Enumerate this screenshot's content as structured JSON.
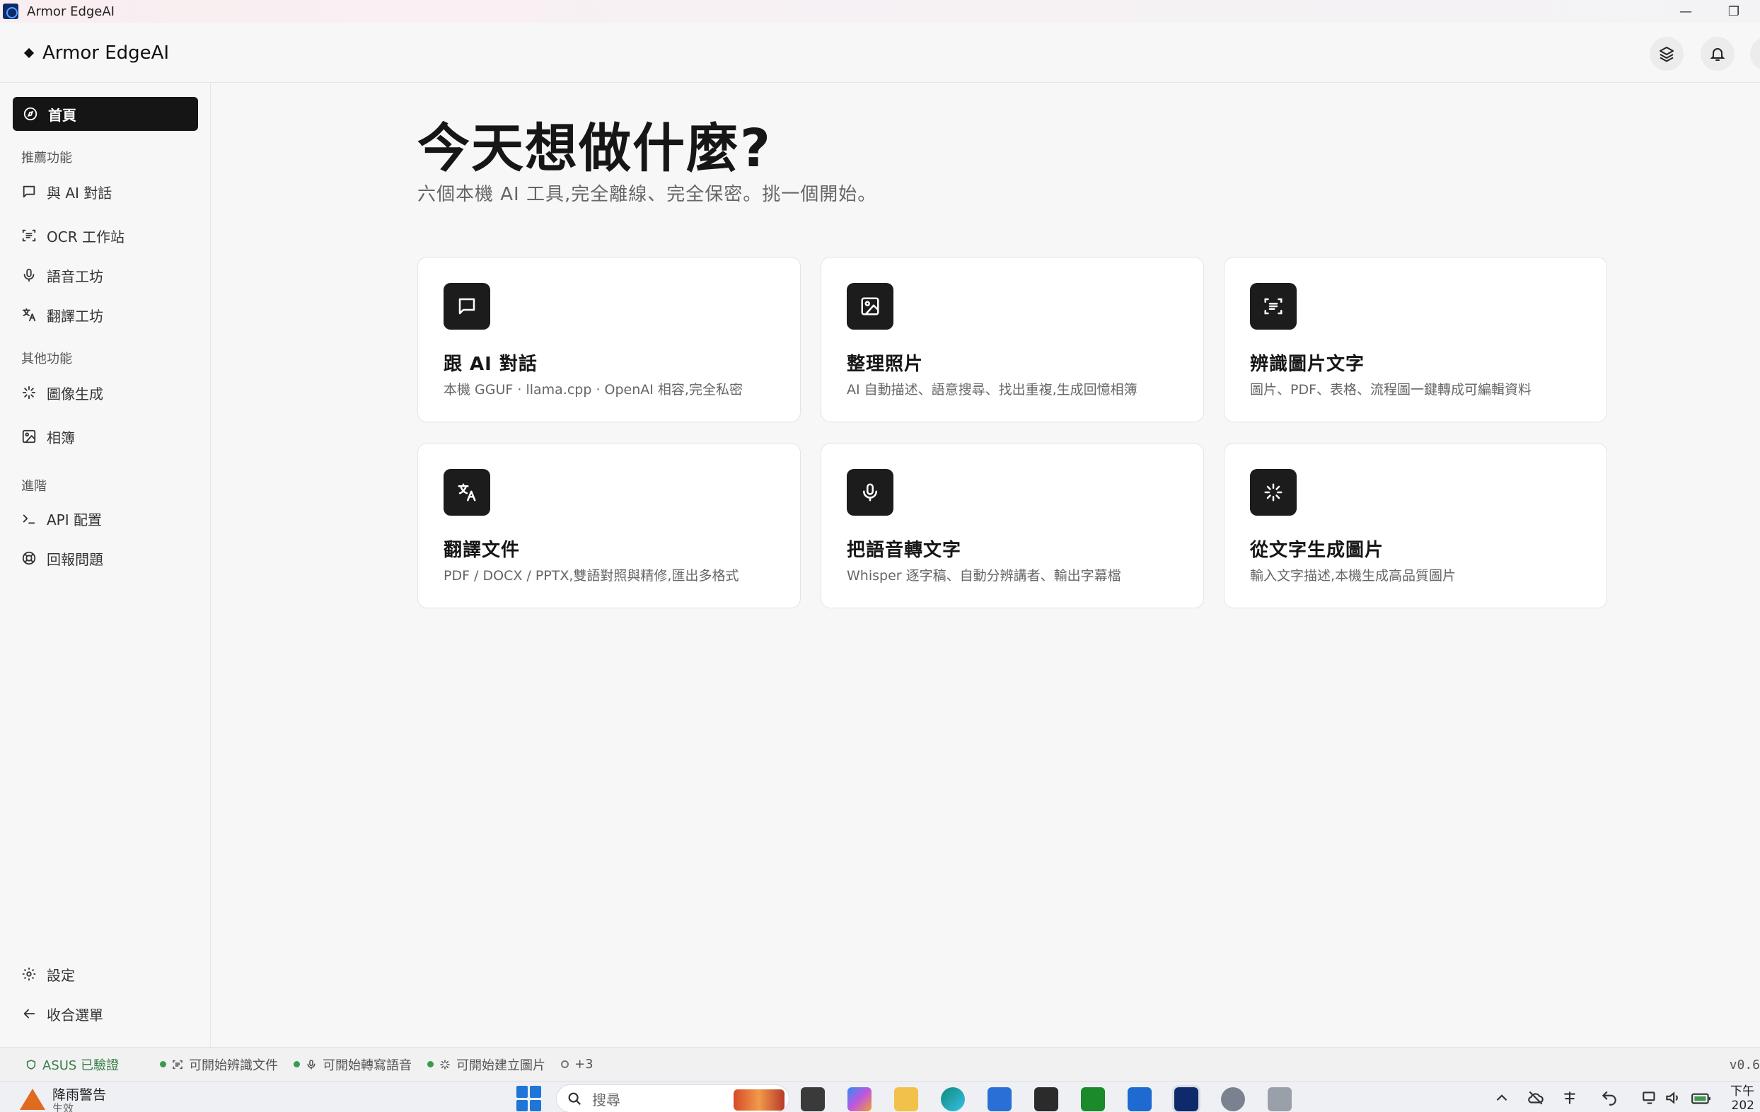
{
  "window": {
    "title": "Armor EdgeAI",
    "minimize_glyph": "—",
    "restore_glyph": "❐"
  },
  "header": {
    "brand": "Armor EdgeAI",
    "layers_icon": "layers-icon",
    "bell_icon": "bell-icon"
  },
  "sidebar": {
    "home": "首頁",
    "sections": {
      "recommended": "推薦功能",
      "other": "其他功能",
      "advanced": "進階"
    },
    "items": {
      "chat": "與 AI 對話",
      "ocr": "OCR 工作站",
      "voice": "語音工坊",
      "translate": "翻譯工坊",
      "image_gen": "圖像生成",
      "album": "相簿",
      "api": "API 配置",
      "report": "回報問題",
      "settings": "設定",
      "collapse": "收合選單"
    }
  },
  "main": {
    "title": "今天想做什麼?",
    "subtitle": "六個本機 AI 工具,完全離線、完全保密。挑一個開始。",
    "cards": [
      {
        "title": "跟 AI 對話",
        "desc": "本機 GGUF · llama.cpp · OpenAI 相容,完全私密",
        "icon": "chat-icon"
      },
      {
        "title": "整理照片",
        "desc": "AI 自動描述、語意搜尋、找出重複,生成回憶相簿",
        "icon": "image-icon"
      },
      {
        "title": "辨識圖片文字",
        "desc": "圖片、PDF、表格、流程圖一鍵轉成可編輯資料",
        "icon": "scan-text-icon"
      },
      {
        "title": "翻譯文件",
        "desc": "PDF / DOCX / PPTX,雙語對照與精修,匯出多格式",
        "icon": "translate-icon"
      },
      {
        "title": "把語音轉文字",
        "desc": "Whisper 逐字稿、自動分辨講者、輸出字幕檔",
        "icon": "mic-icon"
      },
      {
        "title": "從文字生成圖片",
        "desc": "輸入文字描述,本機生成高品質圖片",
        "icon": "sparkle-loader-icon"
      }
    ]
  },
  "statusbar": {
    "verified": "ASUS 已驗證",
    "ocr_ready": "可開始辨識文件",
    "asr_ready": "可開始轉寫語音",
    "image_ready": "可開始建立圖片",
    "more": "+3",
    "version": "v0.6",
    "status_color": "#3a9b4e"
  },
  "taskbar": {
    "weather_title": "降雨警告",
    "weather_sub": "生效",
    "search_placeholder": "搜尋",
    "clock": "下午",
    "date": "202"
  },
  "colors": {
    "accent": "#151515",
    "background": "#f7f7f7",
    "card": "#ffffff"
  }
}
